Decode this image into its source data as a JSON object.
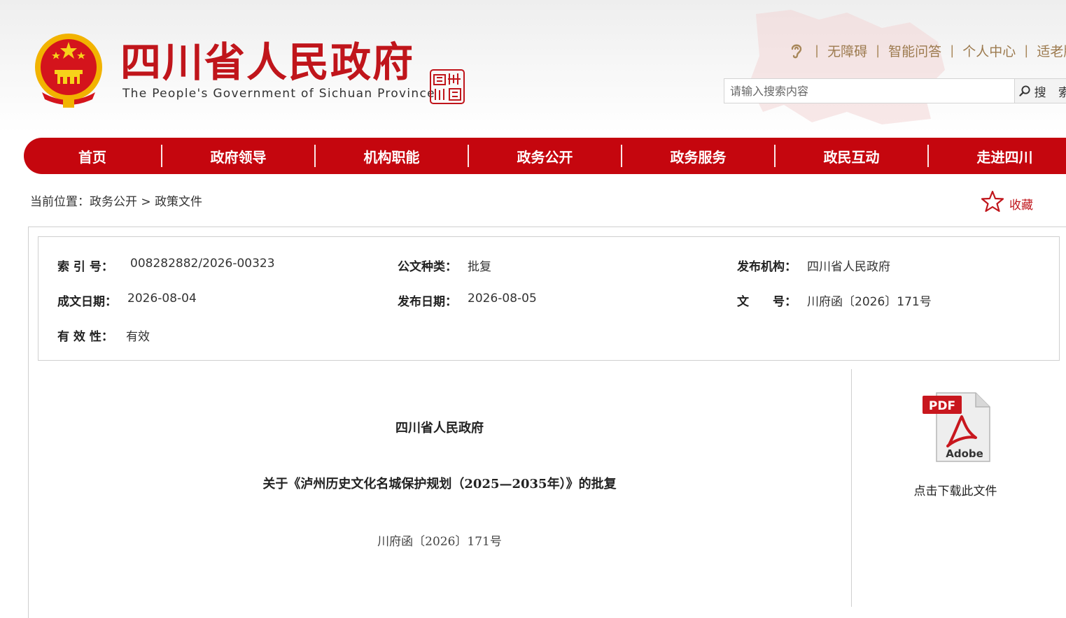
{
  "header": {
    "site_title": "四川省人民政府",
    "site_subtitle": "The People's Government of Sichuan Province",
    "seal_text": "四川中國",
    "top_links": [
      "无障碍",
      "智能问答",
      "个人中心",
      "适老版"
    ],
    "accessibility_icon": "ear-icon",
    "search": {
      "placeholder": "请输入搜索内容",
      "button_label": "搜 索"
    }
  },
  "nav": {
    "items": [
      "首页",
      "政府领导",
      "机构职能",
      "政务公开",
      "政务服务",
      "政民互动",
      "走进四川"
    ]
  },
  "breadcrumb": {
    "prefix": "当前位置：",
    "items": [
      "政务公开",
      "政策文件"
    ],
    "separator": " > "
  },
  "favorite": {
    "label": "收藏",
    "icon": "star-icon"
  },
  "meta": {
    "index_label": "索 引 号：",
    "index_value": "008282882/2026-00323",
    "doc_type_label": "公文种类：",
    "doc_type_value": "批复",
    "issuer_label": "发布机构：",
    "issuer_value": "四川省人民政府",
    "written_date_label": "成文日期：",
    "written_date_value": "2026-08-04",
    "publish_date_label": "发布日期：",
    "publish_date_value": "2026-08-05",
    "doc_no_label": "文　　号：",
    "doc_no_value": "川府函〔2026〕171号",
    "validity_label": "有 效 性：",
    "validity_value": "有效"
  },
  "document": {
    "issuer": "四川省人民政府",
    "title": "关于《泸州历史文化名城保护规划（2025—2035年）》的批复",
    "number": "川府函〔2026〕171号"
  },
  "download": {
    "icon_text_top": "PDF",
    "icon_text_bottom": "Adobe",
    "label": "点击下载此文件"
  },
  "colors": {
    "brand_red": "#c5060e",
    "link_gold": "#9c7a4e"
  }
}
